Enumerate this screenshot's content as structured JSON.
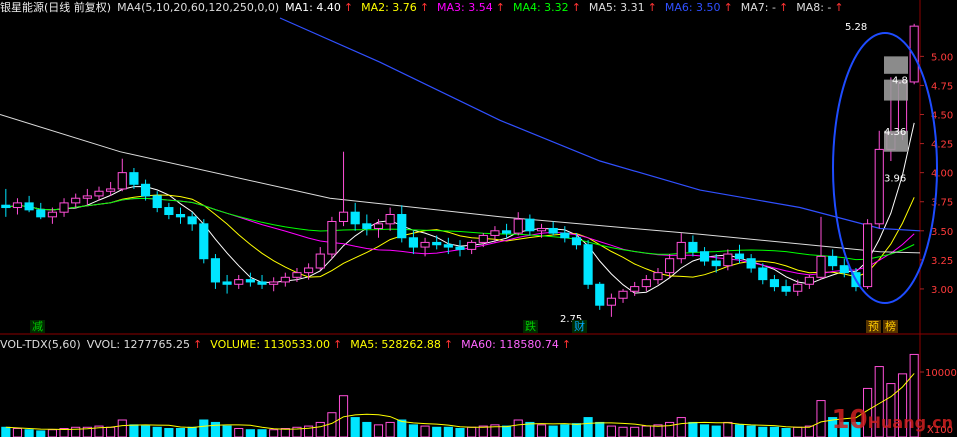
{
  "header": {
    "stock": "银星能源(日线 前复权)",
    "ma_def": "MA4(5,10,20,60,120,250,0,0)",
    "ma_items": [
      {
        "label": "MA1: 4.40",
        "color": "#ffffff"
      },
      {
        "label": "MA2: 3.76",
        "color": "#ffff00"
      },
      {
        "label": "MA3: 3.54",
        "color": "#ff00ff"
      },
      {
        "label": "MA4: 3.32",
        "color": "#00ff00"
      },
      {
        "label": "MA5: 3.31",
        "color": "#dddddd"
      },
      {
        "label": "MA6: 3.50",
        "color": "#3050ff"
      },
      {
        "label": "MA7: -",
        "color": "#dddddd"
      },
      {
        "label": "MA8: -",
        "color": "#dddddd"
      }
    ]
  },
  "vol_header": {
    "def": "VOL-TDX(5,60)",
    "items": [
      {
        "label": "VVOL: 1277765.25",
        "color": "#dddddd"
      },
      {
        "label": "VOLUME: 1130533.00",
        "color": "#ffff00"
      },
      {
        "label": "MA5: 528262.88",
        "color": "#ffff00"
      },
      {
        "label": "MA60: 118580.74",
        "color": "#ff66ff"
      }
    ]
  },
  "chart_data": {
    "type": "candlestick",
    "price_axis": {
      "ticks": [
        3.0,
        3.25,
        3.5,
        3.75,
        4.0,
        4.25,
        4.5,
        4.75,
        5.0
      ],
      "labels": [
        "3.00",
        "3.25",
        "3.50",
        "3.75",
        "4.00",
        "4.25",
        "4.50",
        "4.75",
        "5.00"
      ],
      "ylim": [
        2.75,
        5.33
      ]
    },
    "volume_axis": {
      "ticks": [
        10000
      ],
      "labels": [
        "10000"
      ],
      "unit": "X100"
    },
    "annotations": [
      {
        "text": "5.28",
        "type": "high"
      },
      {
        "text": "4.8",
        "type": "level"
      },
      {
        "text": "4.36",
        "type": "level"
      },
      {
        "text": "3.96",
        "type": "level"
      },
      {
        "text": "2.75",
        "type": "low"
      }
    ],
    "markers": [
      {
        "text": "减",
        "color": "#00cc00"
      },
      {
        "text": "跌",
        "color": "#00cc00"
      },
      {
        "text": "财",
        "color": "#00aaff"
      },
      {
        "text": "预",
        "color": "#ffcc00"
      },
      {
        "text": "榜",
        "color": "#ffcc00"
      }
    ],
    "ohlc": [
      [
        3.72,
        3.86,
        3.62,
        3.7
      ],
      [
        3.7,
        3.78,
        3.64,
        3.74
      ],
      [
        3.74,
        3.8,
        3.66,
        3.68
      ],
      [
        3.68,
        3.74,
        3.6,
        3.62
      ],
      [
        3.62,
        3.7,
        3.56,
        3.66
      ],
      [
        3.66,
        3.78,
        3.62,
        3.74
      ],
      [
        3.74,
        3.82,
        3.7,
        3.78
      ],
      [
        3.78,
        3.86,
        3.72,
        3.8
      ],
      [
        3.8,
        3.88,
        3.76,
        3.84
      ],
      [
        3.84,
        3.92,
        3.8,
        3.86
      ],
      [
        3.86,
        4.12,
        3.84,
        4.0
      ],
      [
        4.0,
        4.04,
        3.86,
        3.9
      ],
      [
        3.9,
        3.94,
        3.76,
        3.8
      ],
      [
        3.8,
        3.84,
        3.66,
        3.7
      ],
      [
        3.7,
        3.74,
        3.6,
        3.64
      ],
      [
        3.64,
        3.7,
        3.56,
        3.62
      ],
      [
        3.62,
        3.66,
        3.5,
        3.56
      ],
      [
        3.56,
        3.6,
        3.22,
        3.26
      ],
      [
        3.26,
        3.3,
        3.0,
        3.06
      ],
      [
        3.06,
        3.12,
        2.96,
        3.04
      ],
      [
        3.04,
        3.12,
        3.0,
        3.08
      ],
      [
        3.08,
        3.14,
        3.02,
        3.06
      ],
      [
        3.06,
        3.12,
        3.0,
        3.04
      ],
      [
        3.04,
        3.1,
        2.98,
        3.06
      ],
      [
        3.06,
        3.14,
        3.02,
        3.1
      ],
      [
        3.1,
        3.18,
        3.06,
        3.14
      ],
      [
        3.14,
        3.22,
        3.08,
        3.18
      ],
      [
        3.18,
        3.36,
        3.16,
        3.3
      ],
      [
        3.3,
        3.62,
        3.26,
        3.58
      ],
      [
        3.58,
        4.18,
        3.54,
        3.66
      ],
      [
        3.66,
        3.74,
        3.5,
        3.56
      ],
      [
        3.56,
        3.64,
        3.46,
        3.52
      ],
      [
        3.52,
        3.6,
        3.44,
        3.56
      ],
      [
        3.56,
        3.7,
        3.5,
        3.64
      ],
      [
        3.64,
        3.72,
        3.4,
        3.44
      ],
      [
        3.44,
        3.5,
        3.3,
        3.36
      ],
      [
        3.36,
        3.44,
        3.28,
        3.4
      ],
      [
        3.4,
        3.46,
        3.34,
        3.38
      ],
      [
        3.38,
        3.44,
        3.3,
        3.36
      ],
      [
        3.36,
        3.42,
        3.28,
        3.34
      ],
      [
        3.34,
        3.42,
        3.3,
        3.4
      ],
      [
        3.4,
        3.48,
        3.36,
        3.46
      ],
      [
        3.46,
        3.54,
        3.4,
        3.5
      ],
      [
        3.5,
        3.56,
        3.44,
        3.48
      ],
      [
        3.48,
        3.66,
        3.46,
        3.6
      ],
      [
        3.6,
        3.64,
        3.46,
        3.5
      ],
      [
        3.5,
        3.56,
        3.44,
        3.52
      ],
      [
        3.52,
        3.58,
        3.46,
        3.48
      ],
      [
        3.48,
        3.54,
        3.4,
        3.44
      ],
      [
        3.44,
        3.48,
        3.34,
        3.38
      ],
      [
        3.38,
        3.42,
        3.0,
        3.04
      ],
      [
        3.04,
        3.06,
        2.82,
        2.86
      ],
      [
        2.86,
        2.96,
        2.76,
        2.92
      ],
      [
        2.92,
        3.0,
        2.88,
        2.98
      ],
      [
        2.98,
        3.06,
        2.94,
        3.02
      ],
      [
        3.02,
        3.12,
        2.98,
        3.08
      ],
      [
        3.08,
        3.18,
        3.04,
        3.14
      ],
      [
        3.14,
        3.3,
        3.1,
        3.26
      ],
      [
        3.26,
        3.48,
        3.22,
        3.4
      ],
      [
        3.4,
        3.46,
        3.28,
        3.32
      ],
      [
        3.32,
        3.36,
        3.2,
        3.24
      ],
      [
        3.24,
        3.3,
        3.14,
        3.2
      ],
      [
        3.2,
        3.34,
        3.16,
        3.3
      ],
      [
        3.3,
        3.38,
        3.22,
        3.26
      ],
      [
        3.26,
        3.3,
        3.14,
        3.18
      ],
      [
        3.18,
        3.22,
        3.04,
        3.08
      ],
      [
        3.08,
        3.12,
        2.98,
        3.02
      ],
      [
        3.02,
        3.08,
        2.94,
        2.98
      ],
      [
        2.98,
        3.08,
        2.94,
        3.04
      ],
      [
        3.04,
        3.12,
        3.0,
        3.1
      ],
      [
        3.1,
        3.62,
        3.08,
        3.28
      ],
      [
        3.28,
        3.34,
        3.16,
        3.2
      ],
      [
        3.2,
        3.26,
        3.1,
        3.14
      ],
      [
        3.14,
        3.18,
        2.98,
        3.02
      ],
      [
        3.02,
        3.6,
        3.0,
        3.56
      ],
      [
        3.56,
        4.36,
        3.52,
        4.2
      ],
      [
        4.2,
        4.82,
        4.1,
        4.34
      ],
      [
        4.34,
        4.8,
        4.28,
        4.78
      ],
      [
        4.78,
        5.28,
        4.76,
        5.26
      ]
    ],
    "volume": [
      8,
      7,
      6,
      5,
      6,
      7,
      8,
      8,
      9,
      8,
      14,
      10,
      9,
      8,
      7,
      7,
      8,
      14,
      12,
      9,
      7,
      6,
      6,
      6,
      7,
      8,
      9,
      12,
      20,
      34,
      16,
      12,
      10,
      12,
      14,
      10,
      9,
      8,
      8,
      7,
      8,
      9,
      10,
      9,
      14,
      12,
      10,
      9,
      10,
      11,
      16,
      12,
      9,
      8,
      8,
      9,
      10,
      12,
      16,
      12,
      10,
      9,
      12,
      10,
      9,
      8,
      8,
      7,
      8,
      9,
      30,
      16,
      12,
      12,
      40,
      58,
      44,
      52,
      68
    ]
  }
}
